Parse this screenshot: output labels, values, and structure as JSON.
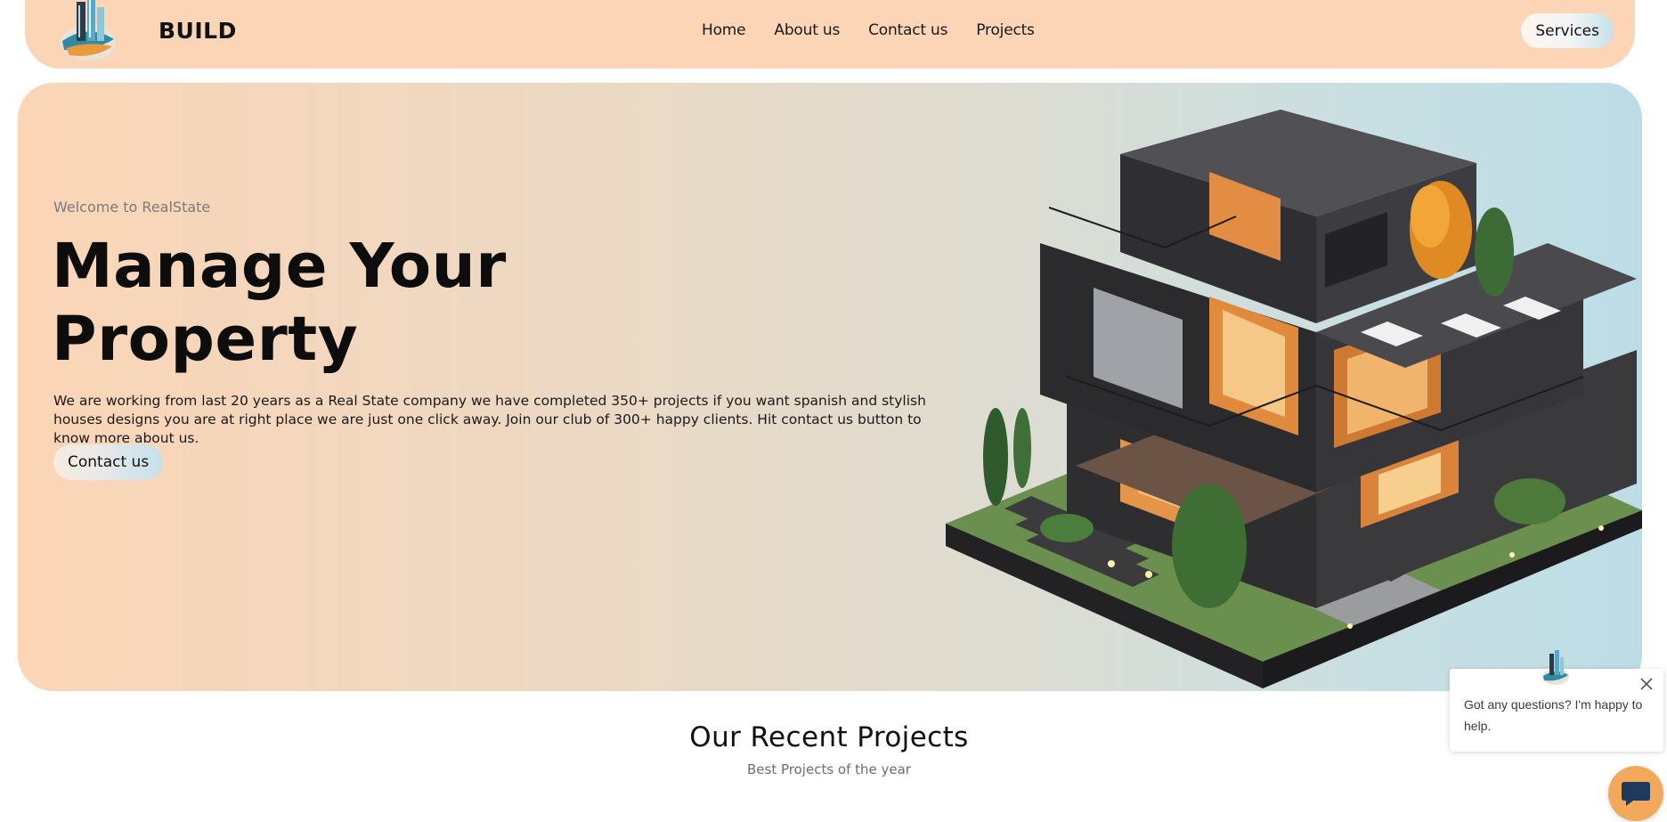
{
  "brand": {
    "name": "BUILD",
    "logo_icon": "building-globe-logo-icon"
  },
  "nav": {
    "links": [
      {
        "label": "Home"
      },
      {
        "label": "About us"
      },
      {
        "label": "Contact us"
      },
      {
        "label": "Projects"
      }
    ],
    "services_label": "Services"
  },
  "hero": {
    "eyebrow": "Welcome to RealState",
    "title": "Manage Your Property",
    "description": "We are working from last 20 years as a Real State company we have completed 350+ projects if you want spanish and stylish houses designs you are at right place we are just one click away. Join our club of 300+ happy clients. Hit contact us button to know more about us.",
    "cta_label": "Contact us",
    "image": "modern-house-render"
  },
  "projects": {
    "title": "Our Recent Projects",
    "subtitle": "Best Projects of the year"
  },
  "chat": {
    "message": "Got any questions? I'm happy to help.",
    "close_icon": "close-icon",
    "launcher_icon": "chat-bubble-icon"
  },
  "colors": {
    "nav_bg": "#fbd5b5",
    "hero_left": "#fbd5b6",
    "hero_right": "#bddde6",
    "launcher": "#f3a95b"
  }
}
